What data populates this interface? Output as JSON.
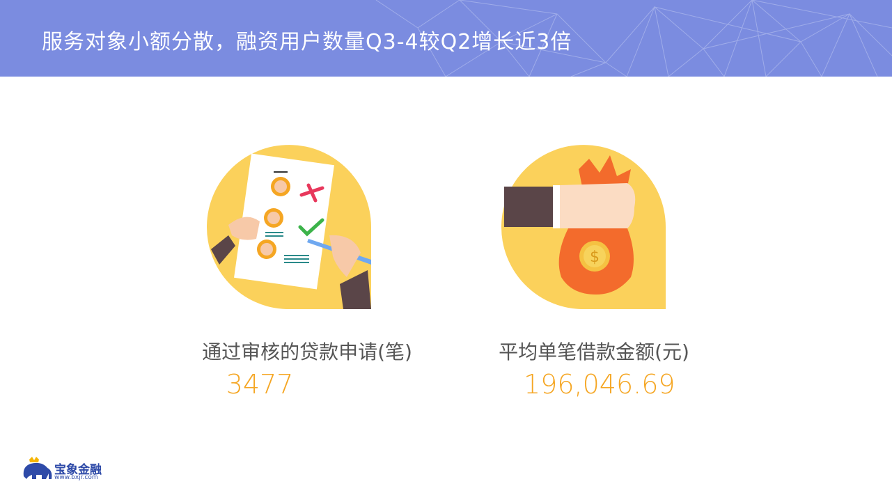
{
  "header": {
    "title": "服务对象小额分散，融资用户数量Q3-4较Q2增长近3倍",
    "background_color": "#7b8ce0"
  },
  "stats": [
    {
      "label": "通过审核的贷款申请(笔)",
      "value": "3477",
      "icon": "approved-application-icon"
    },
    {
      "label": "平均单笔借款金额(元)",
      "value": "196,046.69",
      "icon": "money-bag-icon"
    }
  ],
  "accent_color": "#f5a623",
  "logo": {
    "name": "宝象金融",
    "url": "www.bxjr.com",
    "icon": "elephant-logo-icon"
  }
}
